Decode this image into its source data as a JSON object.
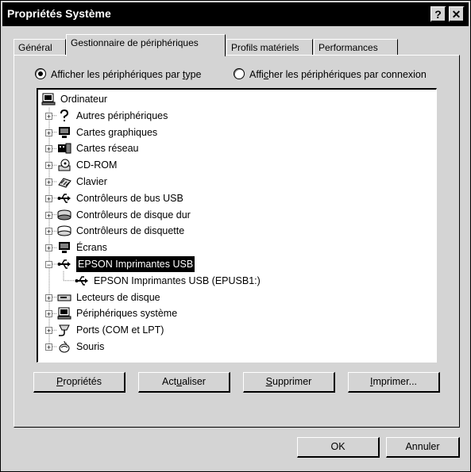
{
  "window": {
    "title": "Propriétés Système",
    "help_label": "?",
    "close_label": "✕"
  },
  "tabs": [
    {
      "label": "Général"
    },
    {
      "label": "Gestionnaire de périphériques"
    },
    {
      "label": "Profils matériels"
    },
    {
      "label": "Performances"
    }
  ],
  "view_options": {
    "by_type": {
      "pre": "Afficher les périphériques par ",
      "key": "t",
      "post": "ype",
      "checked": true
    },
    "by_connection": {
      "pre": "Affi",
      "key": "c",
      "post": "her les périphériques par connexion",
      "checked": false
    }
  },
  "tree": {
    "root": {
      "label": "Ordinateur",
      "icon": "computer-icon"
    },
    "items": [
      {
        "label": "Autres périphériques",
        "icon": "question-icon"
      },
      {
        "label": "Cartes graphiques",
        "icon": "monitor-icon"
      },
      {
        "label": "Cartes réseau",
        "icon": "network-card-icon"
      },
      {
        "label": "CD-ROM",
        "icon": "cdrom-icon"
      },
      {
        "label": "Clavier",
        "icon": "keyboard-icon"
      },
      {
        "label": "Contrôleurs de bus USB",
        "icon": "usb-icon"
      },
      {
        "label": "Contrôleurs de disque dur",
        "icon": "disk-controller-icon"
      },
      {
        "label": "Contrôleurs de disquette",
        "icon": "floppy-controller-icon"
      },
      {
        "label": "Écrans",
        "icon": "monitor-icon"
      },
      {
        "label": "EPSON Imprimantes USB",
        "icon": "usb-icon",
        "expanded": true,
        "selected": true
      },
      {
        "label": "EPSON Imprimantes USB (EPUSB1:)",
        "icon": "usb-icon",
        "child": true
      },
      {
        "label": "Lecteurs de disque",
        "icon": "disk-drive-icon"
      },
      {
        "label": "Périphériques système",
        "icon": "computer-icon"
      },
      {
        "label": "Ports (COM et LPT)",
        "icon": "port-icon"
      },
      {
        "label": "Souris",
        "icon": "mouse-icon"
      }
    ]
  },
  "buttons": {
    "properties": {
      "key": "P",
      "rest": "ropriétés"
    },
    "refresh": {
      "pre": "Act",
      "key": "u",
      "post": "aliser"
    },
    "remove": {
      "key": "S",
      "rest": "upprimer"
    },
    "print": {
      "key": "I",
      "rest": "mprimer..."
    },
    "ok": "OK",
    "cancel": "Annuler"
  },
  "colors": {
    "dialog_bg": "#d4d4d4",
    "titlebar": "#000000",
    "selection": "#000000"
  }
}
